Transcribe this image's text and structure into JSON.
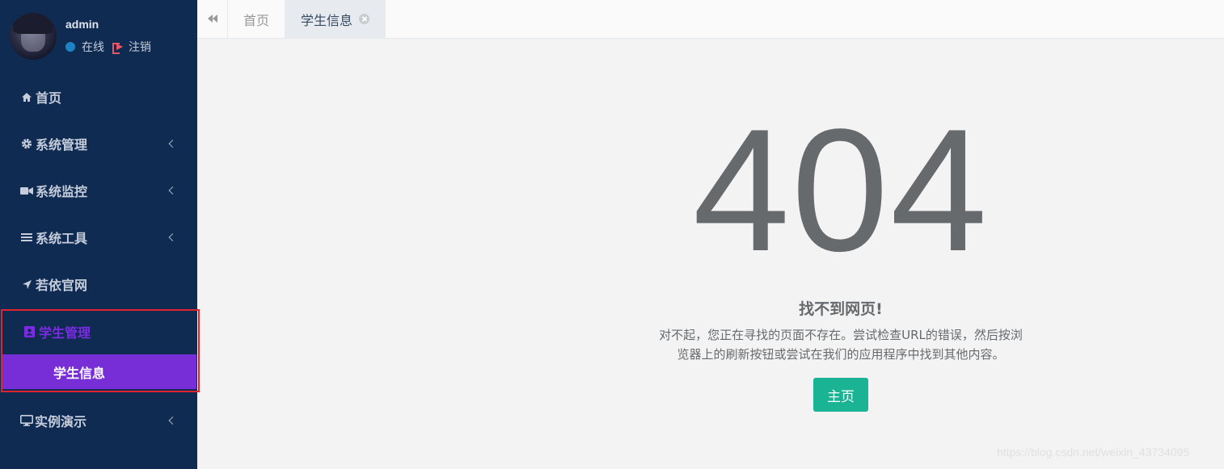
{
  "user": {
    "name": "admin",
    "status": "在线",
    "logout": "注销"
  },
  "menu": {
    "home": "首页",
    "system": "系统管理",
    "monitor": "系统监控",
    "tools": "系统工具",
    "official": "若依官网",
    "student": "学生管理",
    "student_info": "学生信息",
    "demo": "实例演示"
  },
  "tabs": {
    "home": "首页",
    "active": "学生信息"
  },
  "error": {
    "code": "404",
    "title": "找不到网页!",
    "desc_line1": "对不起，您正在寻找的页面不存在。尝试检查URL的错误，然后按浏",
    "desc_line2": "览器上的刷新按钮或尝试在我们的应用程序中找到其他内容。",
    "button": "主页"
  },
  "watermark": "https://blog.csdn.net/weixin_43734095",
  "colors": {
    "sidebar": "#102b52",
    "accent": "#772ed6",
    "primary": "#1ab394",
    "highlight_border": "#e0242f"
  },
  "icons": [
    "home-icon",
    "gear-icon",
    "video-camera-icon",
    "list-icon",
    "location-arrow-icon",
    "contact-card-icon",
    "desktop-icon",
    "double-chevron-left-icon",
    "close-circle-icon",
    "sign-out-icon"
  ]
}
